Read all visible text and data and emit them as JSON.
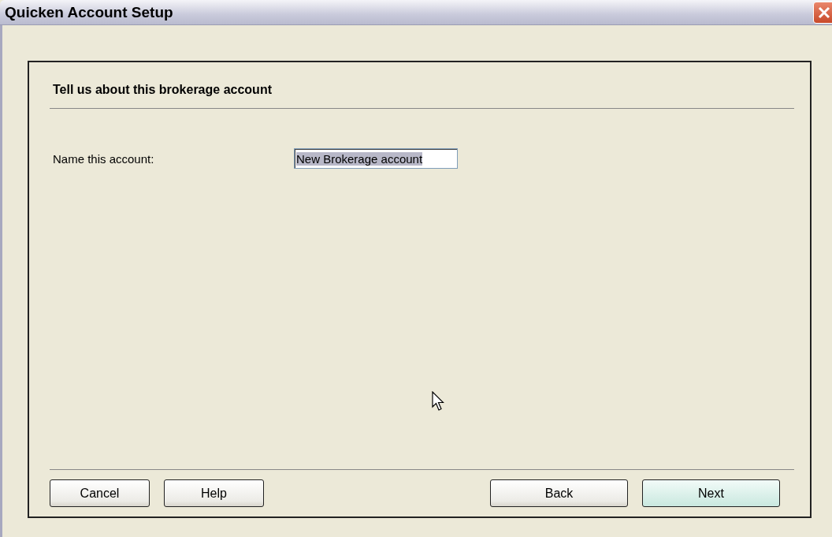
{
  "window": {
    "title": "Quicken Account Setup"
  },
  "heading": "Tell us about this brokerage account",
  "fields": [
    {
      "label": "Name this account:",
      "value": "New Brokerage account",
      "selected": true
    }
  ],
  "buttons_left": [
    {
      "label": "Cancel",
      "default": false
    },
    {
      "label": "Help",
      "default": false
    }
  ],
  "buttons_right": [
    {
      "label": "Back",
      "default": false
    },
    {
      "label": "Next",
      "default": true
    }
  ]
}
